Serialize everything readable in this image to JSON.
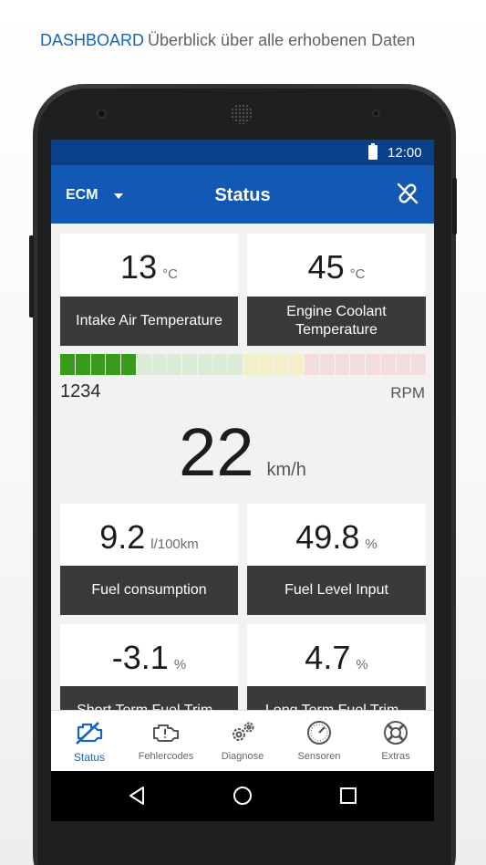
{
  "caption": {
    "heading": "DASHBOARD",
    "subtitle": "Überblick über alle erhobenen Daten"
  },
  "status_bar": {
    "time": "12:00"
  },
  "app_bar": {
    "ecu_selector": "ECM",
    "title": "Status"
  },
  "cards": [
    {
      "value": "13",
      "unit": "°C",
      "label": "Intake Air Temperature"
    },
    {
      "value": "45",
      "unit": "°C",
      "label": "Engine Coolant\nTemperature"
    },
    {
      "value": "9.2",
      "unit": "l/100km",
      "label": "Fuel consumption"
    },
    {
      "value": "49.8",
      "unit": "%",
      "label": "Fuel Level Input"
    },
    {
      "value": "-3.1",
      "unit": "%",
      "label": "Short Term Fuel Trim -"
    },
    {
      "value": "4.7",
      "unit": "%",
      "label": "Long Term Fuel Trim -"
    }
  ],
  "rpm": {
    "value": "1234",
    "unit": "RPM",
    "segments_total": 24,
    "segments_lit": 5,
    "zones": [
      {
        "count": 12,
        "lit_color": "#3a9a1e",
        "unlit_color": "#dcebd5"
      },
      {
        "count": 4,
        "unlit_color": "#f3f0c8"
      },
      {
        "count": 8,
        "unlit_color": "#f3dcdc"
      }
    ]
  },
  "speed": {
    "value": "22",
    "unit": "km/h"
  },
  "bottom_nav": [
    {
      "label": "Status",
      "icon": "engine-check-icon",
      "active": true
    },
    {
      "label": "Fehlercodes",
      "icon": "engine-fault-icon",
      "active": false
    },
    {
      "label": "Diagnose",
      "icon": "gears-icon",
      "active": false
    },
    {
      "label": "Sensoren",
      "icon": "gauge-icon",
      "active": false
    },
    {
      "label": "Extras",
      "icon": "lifebuoy-icon",
      "active": false
    }
  ],
  "colors": {
    "accent": "#1565c0",
    "app_bar": "#1259b6",
    "status_bar": "#0a3f8a",
    "card_label_bg": "#3a3a3a"
  }
}
